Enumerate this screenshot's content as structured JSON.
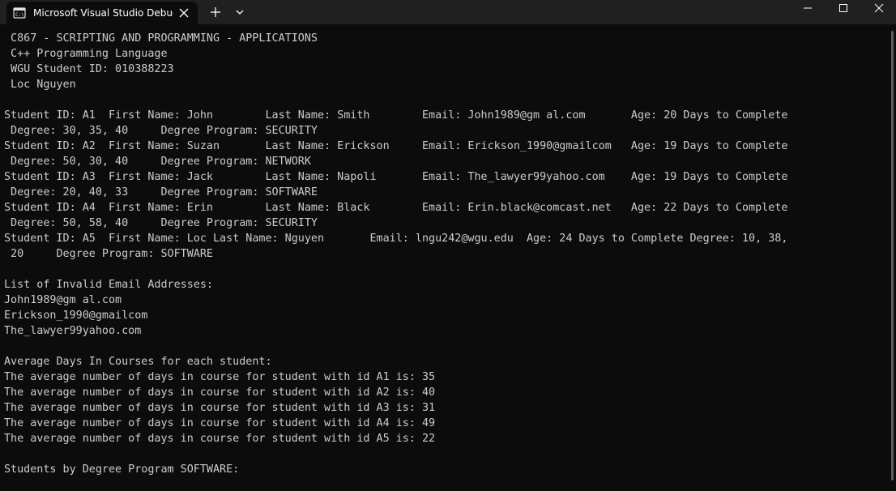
{
  "titlebar": {
    "tab_title": "Microsoft Visual Studio Debug Console",
    "icons": {
      "tab": "console-app-icon",
      "close_tab": "close-icon",
      "new_tab": "plus-icon",
      "dropdown": "chevron-down-icon",
      "minimize": "minimize-icon",
      "maximize": "maximize-icon",
      "close_window": "close-icon"
    }
  },
  "console": {
    "lines": [
      " C867 - SCRIPTING AND PROGRAMMING - APPLICATIONS",
      " C++ Programming Language",
      " WGU Student ID: 010388223",
      " Loc Nguyen",
      "",
      "Student ID: A1  First Name: John        Last Name: Smith        Email: John1989@gm al.com       Age: 20 Days to Complete",
      " Degree: 30, 35, 40     Degree Program: SECURITY",
      "Student ID: A2  First Name: Suzan       Last Name: Erickson     Email: Erickson_1990@gmailcom   Age: 19 Days to Complete",
      " Degree: 50, 30, 40     Degree Program: NETWORK",
      "Student ID: A3  First Name: Jack        Last Name: Napoli       Email: The_lawyer99yahoo.com    Age: 19 Days to Complete",
      " Degree: 20, 40, 33     Degree Program: SOFTWARE",
      "Student ID: A4  First Name: Erin        Last Name: Black        Email: Erin.black@comcast.net   Age: 22 Days to Complete",
      " Degree: 50, 58, 40     Degree Program: SECURITY",
      "Student ID: A5  First Name: Loc Last Name: Nguyen       Email: lngu242@wgu.edu  Age: 24 Days to Complete Degree: 10, 38,",
      " 20     Degree Program: SOFTWARE",
      "",
      "List of Invalid Email Addresses:",
      "John1989@gm al.com",
      "Erickson_1990@gmailcom",
      "The_lawyer99yahoo.com",
      "",
      "Average Days In Courses for each student:",
      "The average number of days in course for student with id A1 is: 35",
      "The average number of days in course for student with id A2 is: 40",
      "The average number of days in course for student with id A3 is: 31",
      "The average number of days in course for student with id A4 is: 49",
      "The average number of days in course for student with id A5 is: 22",
      "",
      "Students by Degree Program SOFTWARE:"
    ]
  },
  "colors": {
    "titlebar_bg": "#202020",
    "console_bg": "#0c0c0c",
    "console_text": "#cccccc",
    "title_text": "#ffffff"
  }
}
